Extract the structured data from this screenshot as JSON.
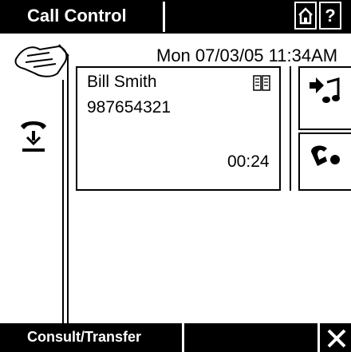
{
  "header": {
    "title": "Call Control",
    "home_icon": "home-icon",
    "help_label": "?"
  },
  "status": {
    "datetime": "Mon 07/03/05 11:34AM"
  },
  "call": {
    "name": "Bill Smith",
    "number": "987654321",
    "timer": "00:24",
    "directory_icon": "phonebook-icon"
  },
  "side_buttons": [
    {
      "icon": "forward-to-voicemail-icon"
    },
    {
      "icon": "consult-transfer-icon"
    }
  ],
  "footer": {
    "title": "Consult/Transfer",
    "close_icon": "close-icon"
  }
}
